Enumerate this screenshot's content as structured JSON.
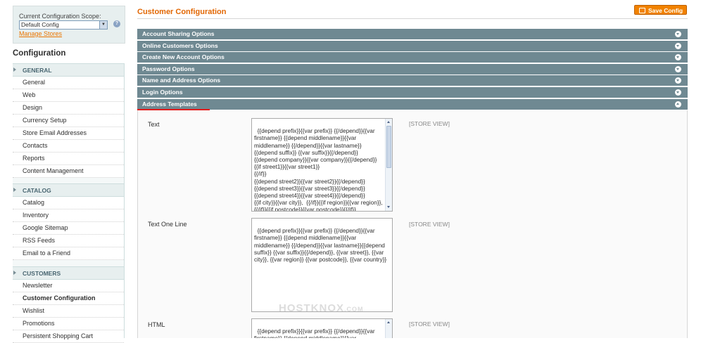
{
  "sidebar": {
    "scope_label": "Current Configuration Scope:",
    "scope_value": "Default Config",
    "help_glyph": "?",
    "manage_stores": "Manage Stores",
    "title": "Configuration",
    "groups": [
      {
        "title": "GENERAL",
        "items": [
          "General",
          "Web",
          "Design",
          "Currency Setup",
          "Store Email Addresses",
          "Contacts",
          "Reports",
          "Content Management"
        ]
      },
      {
        "title": "CATALOG",
        "items": [
          "Catalog",
          "Inventory",
          "Google Sitemap",
          "RSS Feeds",
          "Email to a Friend"
        ]
      },
      {
        "title": "CUSTOMERS",
        "items": [
          "Newsletter",
          "Customer Configuration",
          "Wishlist",
          "Promotions",
          "Persistent Shopping Cart"
        ]
      }
    ]
  },
  "header": {
    "title": "Customer Configuration",
    "save_label": "Save Config"
  },
  "sections": [
    {
      "label": "Account Sharing Options"
    },
    {
      "label": "Online Customers Options"
    },
    {
      "label": "Create New Account Options"
    },
    {
      "label": "Password Options"
    },
    {
      "label": "Name and Address Options"
    },
    {
      "label": "Login Options"
    },
    {
      "label": "Address Templates"
    }
  ],
  "address_templates": {
    "fields": [
      {
        "label": "Text",
        "scope": "[STORE VIEW]",
        "value": "{{depend prefix}}{{var prefix}} {{/depend}}{{var firstname}} {{depend middlename}}{{var middlename}} {{/depend}}{{var lastname}}{{depend suffix}} {{var suffix}}{{/depend}}\n{{depend company}}{{var company}}{{/depend}}\n{{if street1}}{{var street1}}\n{{/if}}\n{{depend street2}}{{var street2}}{{/depend}}\n{{depend street3}}{{var street3}}{{/depend}}\n{{depend street4}}{{var street4}}{{/depend}}\n{{if city}}{{var city}},  {{/if}}{{if region}}{{var region}}, {{/if}}{{if postcode}}{{var postcode}}{{/if}}\n{{var country}}"
      },
      {
        "label": "Text One Line",
        "scope": "[STORE VIEW]",
        "value": "{{depend prefix}}{{var prefix}} {{/depend}}{{var firstname}} {{depend middlename}}{{var middlename}} {{/depend}}{{var lastname}}{{depend suffix}} {{var suffix}}{{/depend}}, {{var street}}, {{var city}}, {{var region}} {{var postcode}}, {{var country}}"
      },
      {
        "label": "HTML",
        "scope": "[STORE VIEW]",
        "value": "{{depend prefix}}{{var prefix}} {{/depend}}{{var firstname}} {{depend middlename}}{{var middlename}} {{/depend}}{{var lastname}}"
      }
    ]
  },
  "watermark": {
    "main": "HOSTKNOX",
    "suffix": ".COM"
  },
  "colors": {
    "accent": "#e26703",
    "section_bar": "#6f8992",
    "save_button": "#f18200"
  }
}
